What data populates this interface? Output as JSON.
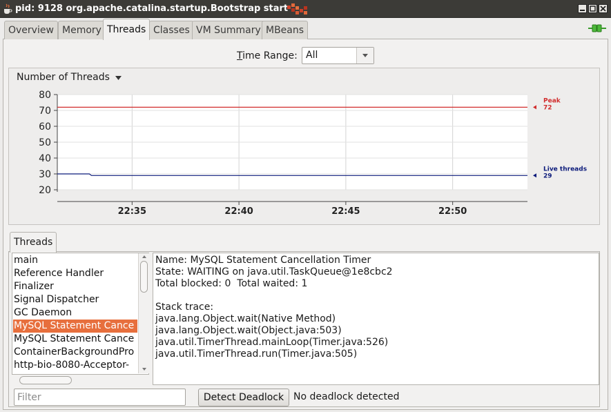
{
  "window": {
    "title": "pid: 9128 org.apache.catalina.startup.Bootstrap start"
  },
  "tabs": [
    {
      "label": "Overview",
      "active": false
    },
    {
      "label": "Memory",
      "active": false
    },
    {
      "label": "Threads",
      "active": true
    },
    {
      "label": "Classes",
      "active": false
    },
    {
      "label": "VM Summary",
      "active": false
    },
    {
      "label": "MBeans",
      "active": false
    }
  ],
  "time_range": {
    "label_mnemonic": "T",
    "label_rest": "ime Range:",
    "value": "All"
  },
  "chart_title": "Number of Threads",
  "chart_data": {
    "type": "line",
    "title": "Number of Threads",
    "xlabel": "",
    "ylabel": "",
    "ylim": [
      20,
      80
    ],
    "yticks": [
      20,
      30,
      40,
      50,
      60,
      70,
      80
    ],
    "x_ticks": [
      "22:35",
      "22:40",
      "22:45",
      "22:50"
    ],
    "x_range_minutes": [
      31.5,
      53.5
    ],
    "grid": true,
    "legend": "right",
    "series": [
      {
        "name": "Peak",
        "color": "#d12b2b",
        "points": [
          [
            31.5,
            72
          ],
          [
            53.5,
            72
          ]
        ],
        "end_label": "72"
      },
      {
        "name": "Live threads",
        "color": "#0b1a7a",
        "points": [
          [
            31.5,
            30
          ],
          [
            33.0,
            30
          ],
          [
            33.1,
            29
          ],
          [
            53.5,
            29
          ]
        ],
        "end_label": "29"
      }
    ]
  },
  "threads_tab_label": "Threads",
  "thread_list": [
    {
      "name": "main",
      "selected": false
    },
    {
      "name": "Reference Handler",
      "selected": false
    },
    {
      "name": "Finalizer",
      "selected": false
    },
    {
      "name": "Signal Dispatcher",
      "selected": false
    },
    {
      "name": "GC Daemon",
      "selected": false
    },
    {
      "name": "MySQL Statement Cance",
      "selected": true
    },
    {
      "name": "MySQL Statement Cance",
      "selected": false
    },
    {
      "name": "ContainerBackgroundPro",
      "selected": false
    },
    {
      "name": "http-bio-8080-Acceptor-",
      "selected": false
    }
  ],
  "thread_detail": {
    "name_line": "Name: MySQL Statement Cancellation Timer",
    "state_line": "State: WAITING on java.util.TaskQueue@1e8cbc2",
    "totals_line": "Total blocked: 0  Total waited: 1",
    "stack_header": "Stack trace:",
    "stack": [
      "java.lang.Object.wait(Native Method)",
      "java.lang.Object.wait(Object.java:503)",
      "java.util.TimerThread.mainLoop(Timer.java:526)",
      "java.util.TimerThread.run(Timer.java:505)"
    ]
  },
  "filter": {
    "placeholder": "Filter",
    "value": ""
  },
  "detect_button_label": "Detect Deadlock",
  "deadlock_status": "No deadlock detected",
  "colors": {
    "selection": "#e76f3d",
    "titlebar": "#3c3b37",
    "peak": "#d12b2b",
    "live": "#0b1a7a"
  }
}
